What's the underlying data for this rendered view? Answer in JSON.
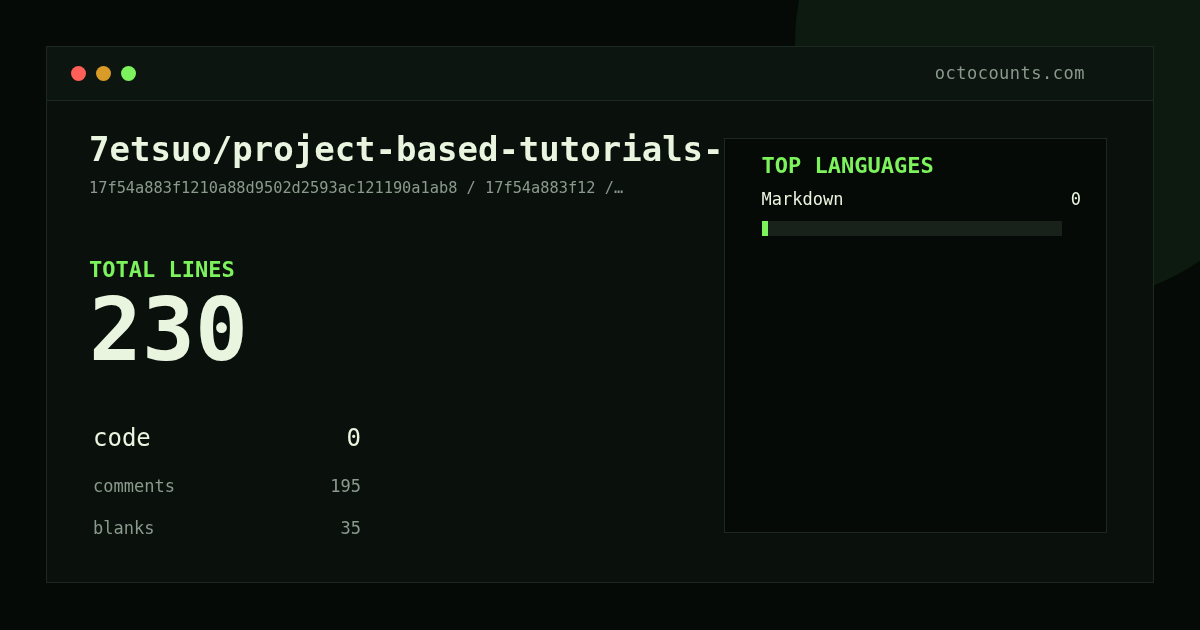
{
  "window": {
    "domain": "octocounts.com",
    "controls": [
      {
        "color": "#ff5f57"
      },
      {
        "color": "#d89b27"
      },
      {
        "color": "#7cf25c"
      }
    ]
  },
  "repo": {
    "title": "7etsuo/project-based-tutorials-",
    "path": "17f54a883f1210a88d9502d2593ac121190a1ab8 / 17f54a883f12 /…"
  },
  "total": {
    "label": "TOTAL LINES",
    "value": "230"
  },
  "stats": [
    {
      "kind": "primary",
      "label": "code",
      "value": "0"
    },
    {
      "kind": "secondary",
      "label": "comments",
      "value": "195"
    },
    {
      "kind": "secondary",
      "label": "blanks",
      "value": "35"
    }
  ],
  "languages": {
    "title": "TOP LANGUAGES",
    "items": [
      {
        "name": "Markdown",
        "value": "0",
        "level": 0.02
      }
    ]
  }
}
